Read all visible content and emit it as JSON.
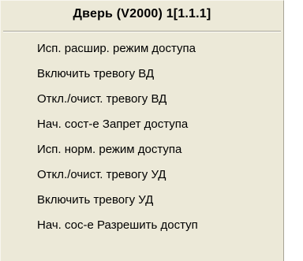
{
  "menu": {
    "title": "Дверь (V2000) 1[1.1.1]",
    "items": [
      {
        "label": "Исп. расшир. режим доступа"
      },
      {
        "label": "Включить тревогу ВД"
      },
      {
        "label": "Откл./очист. тревогу ВД"
      },
      {
        "label": "Нач. сост-е Запрет доступа"
      },
      {
        "label": "Исп. норм. режим доступа"
      },
      {
        "label": "Откл./очист. тревогу УД"
      },
      {
        "label": "Включить тревогу УД"
      },
      {
        "label": "Нач. сос-е Разрешить доступ"
      }
    ]
  },
  "colors": {
    "menu_background": "#ece9d8",
    "text": "#000000",
    "separator_dark": "#a7a394",
    "separator_light": "#ffffff"
  }
}
